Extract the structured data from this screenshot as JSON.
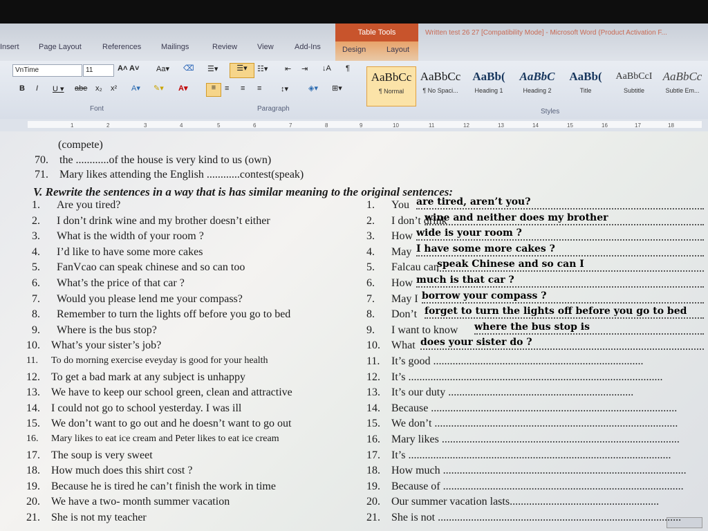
{
  "ribbon_tabs": [
    "Insert",
    "Page Layout",
    "References",
    "Mailings",
    "Review",
    "View",
    "Add-Ins",
    "Design",
    "Layout"
  ],
  "context_tab": "Table Tools",
  "window_title": "Written test 26 27 [Compatibility Mode] - Microsoft Word (Product Activation F...",
  "font": {
    "name": "VnTime",
    "size": "11",
    "group_label": "Font"
  },
  "paragraph_label": "Paragraph",
  "styles_label": "Styles",
  "styles": [
    {
      "preview": "AaBbCc",
      "name": "¶ Normal"
    },
    {
      "preview": "AaBbCc",
      "name": "¶ No Spaci..."
    },
    {
      "preview": "AaBb(",
      "name": "Heading 1"
    },
    {
      "preview": "AaBbC",
      "name": "Heading 2"
    },
    {
      "preview": "AaBb(",
      "name": "Title"
    },
    {
      "preview": "AaBbCcI",
      "name": "Subtitle"
    },
    {
      "preview": "AaBbCc",
      "name": "Subtle Em..."
    }
  ],
  "ruler_numbers": [
    "1",
    "2",
    "3",
    "4",
    "5",
    "6",
    "7",
    "8",
    "9",
    "10",
    "11",
    "12",
    "13",
    "14",
    "15",
    "16",
    "17",
    "18"
  ],
  "doc": {
    "top_cut": "(compete)",
    "item70": {
      "num": "70.",
      "text": "the ............of the house is very kind to us (own)"
    },
    "item71": {
      "num": "71.",
      "text": "Mary likes attending the English ............contest(speak)"
    },
    "heading": "V. Rewrite the sentences in a way that is has similar meaning to the original sentences:",
    "left": [
      {
        "num": "1.",
        "text": "Are you tired?"
      },
      {
        "num": "2.",
        "text": "I don’t drink wine and my brother doesn’t either"
      },
      {
        "num": "3.",
        "text": "What is the width of your room ?"
      },
      {
        "num": "4.",
        "text": "I’d like to have some more cakes"
      },
      {
        "num": "5.",
        "text": "FanVcao can speak chinese and so can too"
      },
      {
        "num": "6.",
        "text": "What’s the price of that car ?"
      },
      {
        "num": "7.",
        "text": "Would you please lend me your compass?"
      },
      {
        "num": "8.",
        "text": "Remember to turn the lights off before you go to bed"
      },
      {
        "num": "9.",
        "text": "Where is the bus stop?"
      },
      {
        "num": "10.",
        "text": "What’s your sister’s job?"
      },
      {
        "num": "11.",
        "text": "To do morning exercise eveyday is good for your health"
      },
      {
        "num": "12.",
        "text": "To get a bad mark at any subject is unhappy"
      },
      {
        "num": "13.",
        "text": "We have to keep our school green, clean and attractive"
      },
      {
        "num": "14.",
        "text": "I could not go to school yesterday. I was ill"
      },
      {
        "num": "15.",
        "text": "We don’t want to go out and he doesn’t want to go out"
      },
      {
        "num": "16.",
        "text": "Mary likes to eat ice cream and Peter likes to eat ice cream"
      },
      {
        "num": "17.",
        "text": "The soup is very sweet"
      },
      {
        "num": "18.",
        "text": "How much does this shirt cost ?"
      },
      {
        "num": "19.",
        "text": "Because he is tired he can’t finish the work in time"
      },
      {
        "num": "20.",
        "text": "We have a two- month summer vacation"
      },
      {
        "num": "21.",
        "text": "She is not my teacher"
      }
    ],
    "right": [
      {
        "num": "1.",
        "text": "You",
        "answer": "are tired, aren’t you?"
      },
      {
        "num": "2.",
        "text": "I don’t drink",
        "answer": "wine and neither does my brother"
      },
      {
        "num": "3.",
        "text": "How",
        "answer": "wide is your room ?"
      },
      {
        "num": "4.",
        "text": "May",
        "answer": "I have some more cakes ?"
      },
      {
        "num": "5.",
        "text": "Falcau can",
        "answer": "speak Chinese and so can I"
      },
      {
        "num": "6.",
        "text": "How",
        "answer": "much is that car ?"
      },
      {
        "num": "7.",
        "text": "May I",
        "answer": "borrow your compass ?"
      },
      {
        "num": "8.",
        "text": "Don’t",
        "answer": "forget to turn the lights off before you go to bed"
      },
      {
        "num": "9.",
        "text": "I want to know",
        "answer": "where the bus stop is"
      },
      {
        "num": "10.",
        "text": "What",
        "answer": "does your sister do ?"
      },
      {
        "num": "11.",
        "text": "It’s good ............................................................................",
        "answer": ""
      },
      {
        "num": "12.",
        "text": "It’s ............................................................................................",
        "answer": ""
      },
      {
        "num": "13.",
        "text": "It’s our duty ...................................................................",
        "answer": ""
      },
      {
        "num": "14.",
        "text": "Because .........................................................................................",
        "answer": ""
      },
      {
        "num": "15.",
        "text": "We don’t ........................................................................................",
        "answer": ""
      },
      {
        "num": "16.",
        "text": "Mary likes ......................................................................................",
        "answer": ""
      },
      {
        "num": "17.",
        "text": "It’s ...............................................................................................",
        "answer": ""
      },
      {
        "num": "18.",
        "text": "How much ........................................................................................",
        "answer": ""
      },
      {
        "num": "19.",
        "text": "Because of .......................................................................................",
        "answer": ""
      },
      {
        "num": "20.",
        "text": "Our summer vacation lasts......................................................",
        "answer": ""
      },
      {
        "num": "21.",
        "text": "She is not ........................................................................................",
        "answer": ""
      }
    ]
  }
}
